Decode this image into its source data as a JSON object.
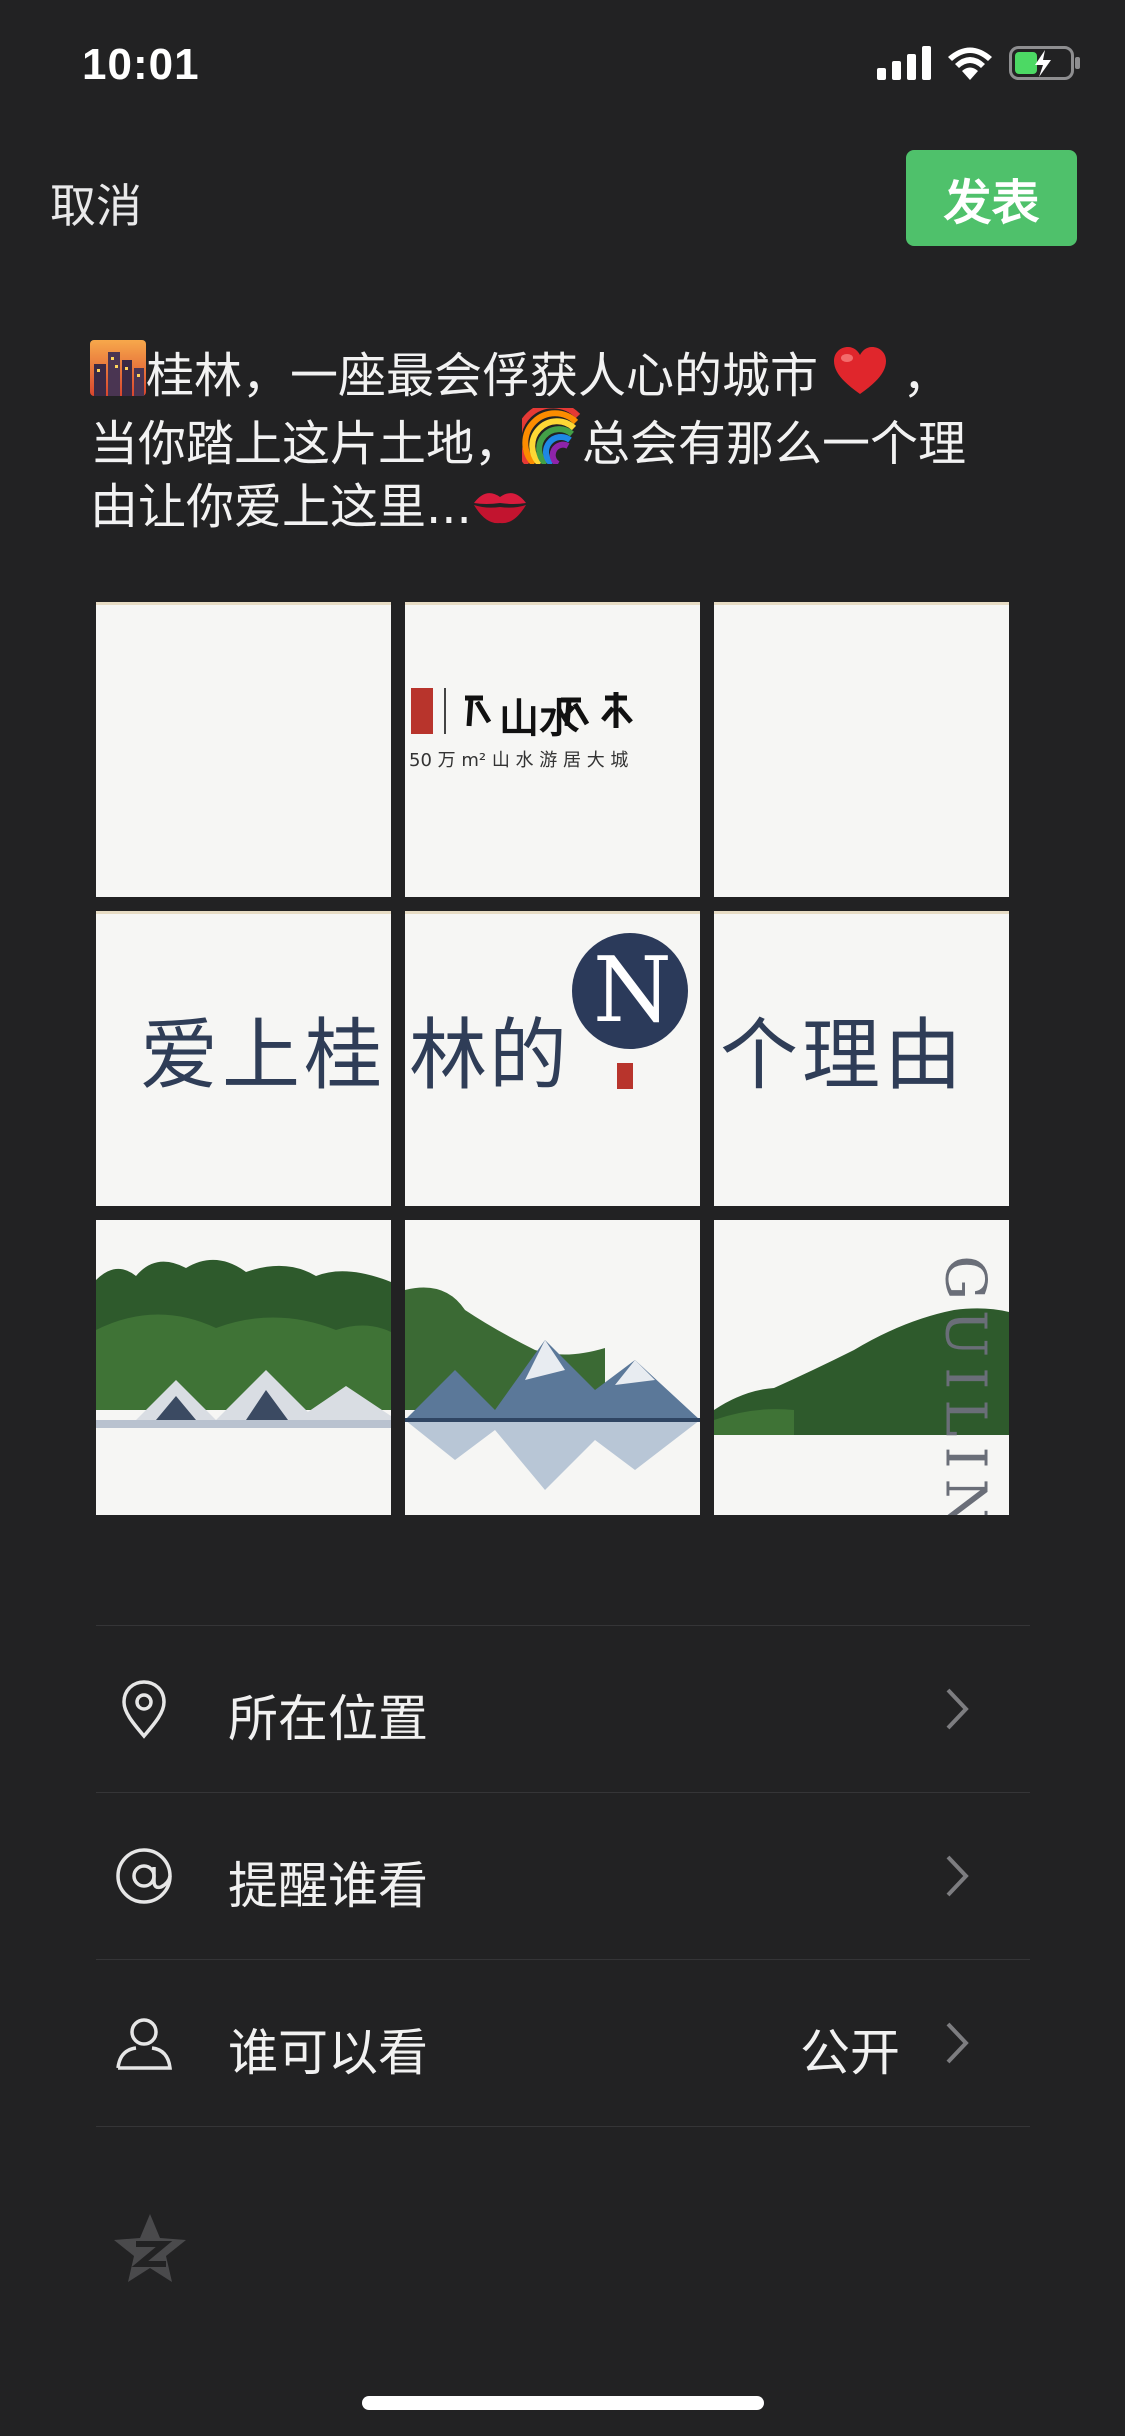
{
  "status_bar": {
    "time": "10:01",
    "icons": [
      "cellular-signal-icon",
      "wifi-icon",
      "battery-charging-icon"
    ]
  },
  "topbar": {
    "cancel_label": "取消",
    "publish_label": "发表",
    "publish_color": "#4fc16b"
  },
  "post": {
    "line1_pre": "",
    "line1_text": "桂林，一座最会俘获人心的城市",
    "line1_tail": "，",
    "line2_text": "当你踏上这片土地，",
    "line2_tail": "总会有那么一个理",
    "line3_text": "由让你爱上这里...",
    "emojis": [
      "cityscape-sunset-emoji",
      "red-heart-emoji",
      "rainbow-emoji",
      "kiss-mark-emoji"
    ]
  },
  "images": {
    "tile_2_brand": "山水",
    "tile_2_sub": "50 万 m² 山 水 游 居 大 城",
    "tile_4_text": "爱上桂",
    "tile_5_text": "林的",
    "tile_5_badge": "N",
    "tile_6_text": "个理由",
    "tile_9_vertical": "GUILIN"
  },
  "menu": {
    "location_label": "所在位置",
    "mention_label": "提醒谁看",
    "visibility_label": "谁可以看",
    "visibility_value": "公开"
  },
  "share": {
    "qzone_icon": "qzone-icon"
  }
}
